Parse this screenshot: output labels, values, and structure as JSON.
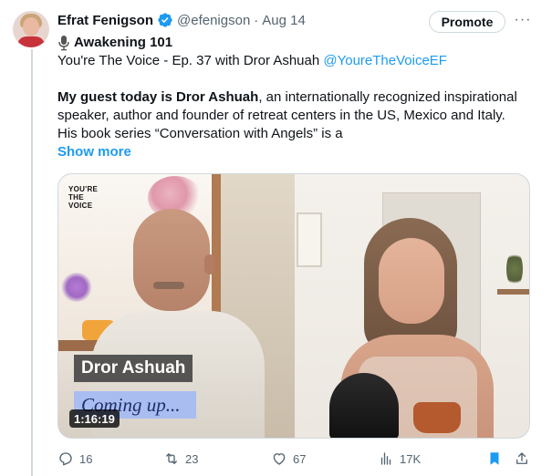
{
  "author": {
    "name": "Efrat Fenigson",
    "handle": "@efenigson",
    "separator": "·",
    "date": "Aug 14"
  },
  "header_actions": {
    "promote_label": "Promote",
    "more_label": "···"
  },
  "tweet": {
    "title": "Awakening 101",
    "subtitle_prefix": "You're The Voice - Ep. 37 with Dror Ashuah ",
    "subtitle_link": "@YoureTheVoiceEF",
    "para_bold": "My guest today is Dror Ashuah",
    "para_line1_rest": ", an internationally recognized inspirational",
    "para_line2": "speaker, author and founder of retreat centers in the US, Mexico and Italy.",
    "para_line3": "His book series “Conversation with Angels” is a",
    "show_more": "Show more"
  },
  "media": {
    "logo_text": "YOU'RE\nTHE\nVOICE",
    "name_tag": "Dror Ashuah",
    "overlay_text": "Coming up...",
    "duration": "1:16:19"
  },
  "actions": {
    "replies": "16",
    "reposts": "23",
    "likes": "67",
    "views": "17K"
  },
  "colors": {
    "accent": "#1d9bf0",
    "muted": "#536471",
    "verified": "#1d9bf0"
  },
  "icons": {
    "verified": "verified-badge-icon",
    "title": "microphone-icon",
    "more": "more-dots-icon",
    "reply": "reply-icon",
    "repost": "repost-icon",
    "like": "heart-icon",
    "views": "views-chart-icon",
    "bookmark": "bookmark-icon",
    "share": "share-icon"
  }
}
